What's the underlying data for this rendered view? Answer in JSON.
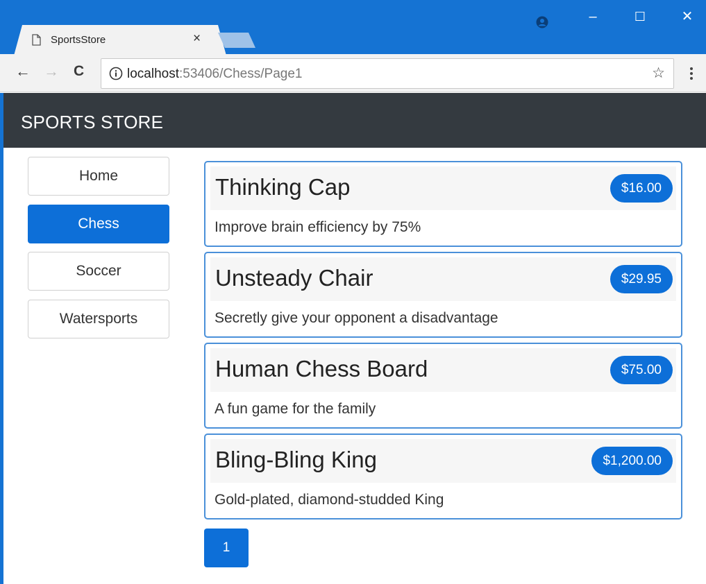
{
  "browser": {
    "tab_title": "SportsStore",
    "tab_close": "×",
    "window_controls": {
      "minimize": "–",
      "maximize": "☐",
      "close": "✕"
    },
    "nav": {
      "back": "←",
      "forward": "→",
      "reload": "C"
    },
    "url_host": "localhost",
    "url_rest": ":53406/Chess/Page1",
    "star": "☆",
    "icons": [
      "document-icon",
      "account-icon",
      "info-icon",
      "star-icon",
      "menu-icon"
    ]
  },
  "site": {
    "brand": "SPORTS STORE"
  },
  "categories": [
    {
      "label": "Home",
      "active": false
    },
    {
      "label": "Chess",
      "active": true
    },
    {
      "label": "Soccer",
      "active": false
    },
    {
      "label": "Watersports",
      "active": false
    }
  ],
  "products": [
    {
      "name": "Thinking Cap",
      "price": "$16.00",
      "description": "Improve brain efficiency by 75%"
    },
    {
      "name": "Unsteady Chair",
      "price": "$29.95",
      "description": "Secretly give your opponent a disadvantage"
    },
    {
      "name": "Human Chess Board",
      "price": "$75.00",
      "description": "A fun game for the family"
    },
    {
      "name": "Bling-Bling King",
      "price": "$1,200.00",
      "description": "Gold-plated, diamond-studded King"
    }
  ],
  "pagination": {
    "pages": [
      "1"
    ],
    "current": "1"
  },
  "colors": {
    "titlebar": "#1573d3",
    "header": "#343a40",
    "primary": "#0d6fd8",
    "card_border": "#4a90d9"
  }
}
